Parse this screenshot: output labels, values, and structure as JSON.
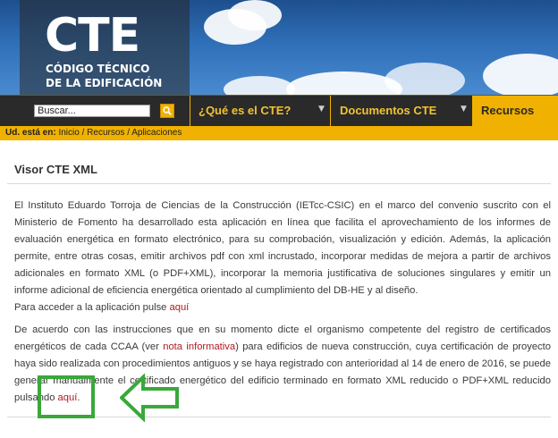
{
  "header": {
    "logo_big": "CTE",
    "logo_line1": "CÓDIGO TÉCNICO",
    "logo_line2": "DE LA EDIFICACIÓN"
  },
  "nav": {
    "search_value": "Buscar...",
    "items": [
      {
        "label": "¿Qué es el CTE?"
      },
      {
        "label": "Documentos CTE"
      },
      {
        "label": "Recursos"
      }
    ]
  },
  "breadcrumb": {
    "prefix": "Ud. está en:",
    "items": [
      "Inicio",
      "Recursos",
      "Aplicaciones"
    ],
    "separator": "/"
  },
  "page": {
    "title": "Visor CTE XML",
    "paragraph1": "El Instituto Eduardo Torroja de Ciencias de la Construcción (IETcc-CSIC) en el marco del convenio suscrito con el Ministerio de Fomento ha desarrollado esta aplicación en línea que facilita el aprovechamiento de los informes de evaluación energética en formato electrónico, para su comprobación, visualización y edición. Además, la aplicación permite, entre otras cosas, emitir archivos pdf con xml incrustado, incorporar medidas de mejora a partir de archivos adicionales en formato XML (o PDF+XML), incorporar la memoria justificativa de soluciones singulares y emitir un informe adicional de eficiencia energética orientado al cumplimiento del DB-HE y al diseño.",
    "paragraph2_text": "Para acceder a la aplicación pulse",
    "paragraph2_link": "aquí",
    "paragraph3_a": "De acuerdo con las instrucciones que en su momento dicte el organismo competente del registro de certificados energéticos de cada CCAA (ver",
    "paragraph3_link1": "nota informativa",
    "paragraph3_b": ") para edificios de nueva construcción, cuya certificación de proyecto haya sido realizada con procedimientos antiguos y se haya registrado con anterioridad al 14 de enero de 2016, se puede generar manualmente el certificado energético del edificio terminado en formato XML reducido o PDF+XML reducido pulsando",
    "paragraph3_link2": "aquí",
    "paragraph3_end": "."
  },
  "colors": {
    "accent": "#f0b100",
    "link": "#b01820",
    "annotation": "#3aa83a"
  }
}
